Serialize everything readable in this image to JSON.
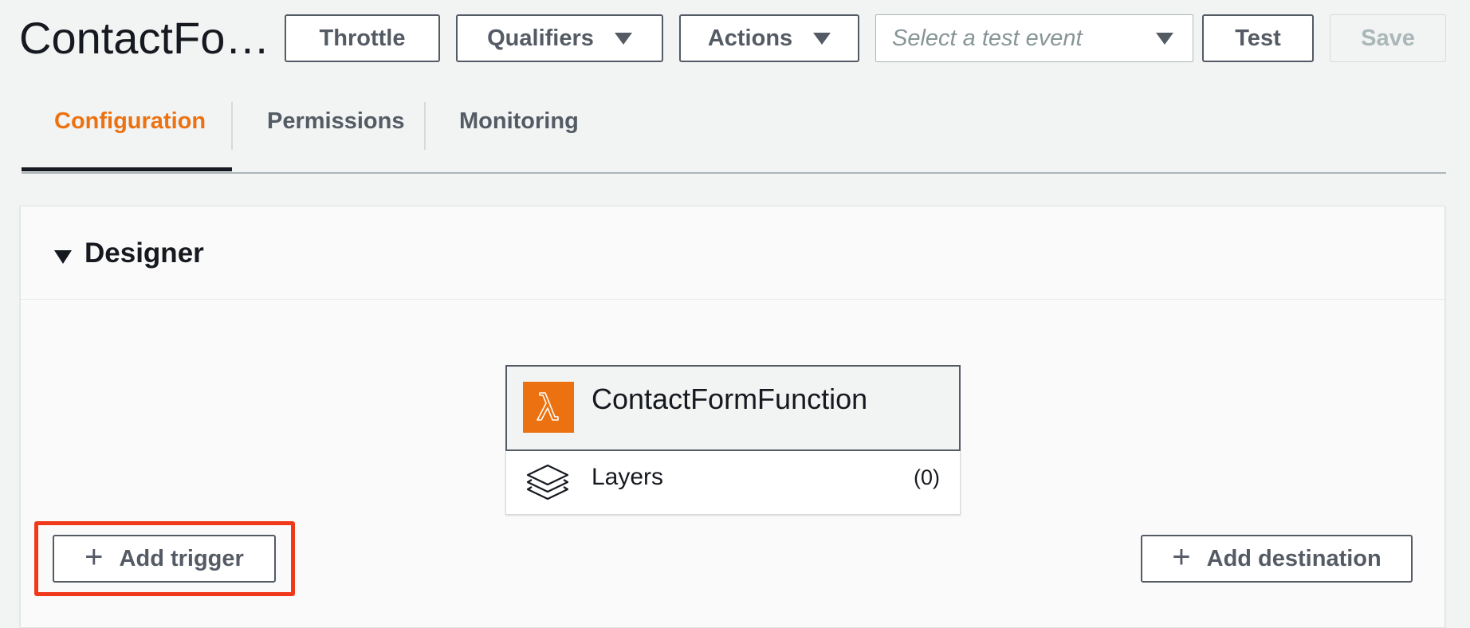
{
  "function": {
    "title_truncated": "ContactFo…",
    "name": "ContactFormFunction"
  },
  "toolbar": {
    "throttle_label": "Throttle",
    "qualifiers_label": "Qualifiers",
    "actions_label": "Actions",
    "test_event_placeholder": "Select a test event",
    "test_label": "Test",
    "save_label": "Save"
  },
  "tabs": [
    {
      "label": "Configuration",
      "active": true
    },
    {
      "label": "Permissions",
      "active": false
    },
    {
      "label": "Monitoring",
      "active": false
    }
  ],
  "designer": {
    "title": "Designer",
    "layers_label": "Layers",
    "layers_count": "(0)",
    "add_trigger_label": "Add trigger",
    "add_destination_label": "Add destination"
  },
  "icons": {
    "function": "lambda-icon",
    "layers": "layers-icon",
    "add": "plus-icon",
    "dropdown": "caret-down-icon",
    "collapse": "caret-down-icon"
  },
  "colors": {
    "accent": "#ec7211",
    "highlight": "#f0391a",
    "text": "#16191f",
    "secondary_text": "#545b64"
  }
}
